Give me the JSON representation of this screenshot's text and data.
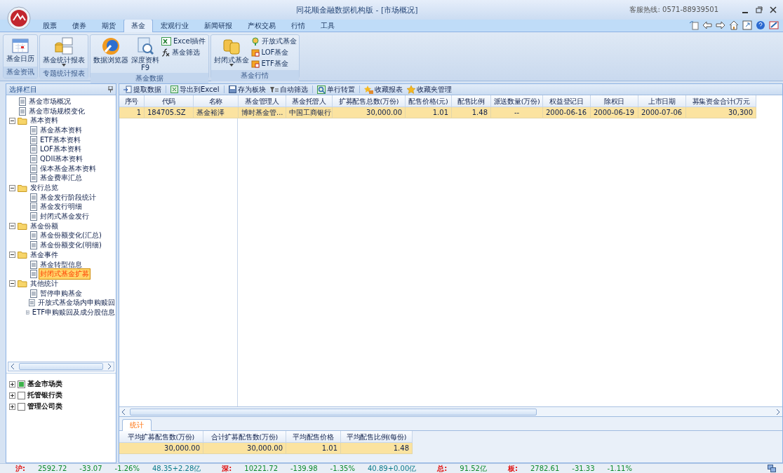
{
  "window": {
    "title": "同花顺金融数据机构版 - [市场概况]",
    "hotline": "客服热线: 0571-88939501"
  },
  "menu_tabs": [
    {
      "label": "股票",
      "selected": false
    },
    {
      "label": "债券",
      "selected": false
    },
    {
      "label": "期货",
      "selected": false
    },
    {
      "label": "基金",
      "selected": true
    },
    {
      "label": "宏观行业",
      "selected": false
    },
    {
      "label": "新闻研报",
      "selected": false
    },
    {
      "label": "产权交易",
      "selected": false
    },
    {
      "label": "行情",
      "selected": false
    },
    {
      "label": "工具",
      "selected": false
    }
  ],
  "ribbon": [
    {
      "label": "基金资讯",
      "items": [
        {
          "kind": "large",
          "label": "基金日历"
        }
      ]
    },
    {
      "label": "专题统计报表",
      "items": [
        {
          "kind": "large",
          "label": "基金统计报表",
          "dropdown": true
        }
      ]
    },
    {
      "label": "基金数据",
      "items": [
        {
          "kind": "large",
          "label": "数据浏览器"
        },
        {
          "kind": "large",
          "label": "深度资料",
          "sublabel": "F9"
        },
        {
          "kind": "small",
          "label": "Excel插件"
        },
        {
          "kind": "small",
          "label": "基金筛选"
        }
      ]
    },
    {
      "label": "基金行情",
      "items": [
        {
          "kind": "large",
          "label": "封闭式基金",
          "dropdown": true
        },
        {
          "kind": "small",
          "label": "开放式基金"
        },
        {
          "kind": "small",
          "label": "LOF基金"
        },
        {
          "kind": "small",
          "label": "ETF基金"
        }
      ]
    }
  ],
  "sidebar": {
    "title": "选择栏目",
    "tree": [
      {
        "label": "基金市场概况",
        "kind": "doc",
        "selected": false
      },
      {
        "label": "基金市场规模变化",
        "kind": "doc",
        "selected": false
      },
      {
        "label": "基本资料",
        "kind": "folder",
        "expanded": true,
        "selected": false,
        "children": [
          {
            "label": "基金基本资料",
            "kind": "doc",
            "selected": false
          },
          {
            "label": "ETF基本资料",
            "kind": "doc",
            "selected": false
          },
          {
            "label": "LOF基本资料",
            "kind": "doc",
            "selected": false
          },
          {
            "label": "QDII基本资料",
            "kind": "doc",
            "selected": false
          },
          {
            "label": "保本基金基本资料",
            "kind": "doc",
            "selected": false
          },
          {
            "label": "基金费率汇总",
            "kind": "doc",
            "selected": false
          }
        ]
      },
      {
        "label": "发行总览",
        "kind": "folder",
        "expanded": true,
        "selected": false,
        "children": [
          {
            "label": "基金发行阶段统计",
            "kind": "doc",
            "selected": false
          },
          {
            "label": "基金发行明细",
            "kind": "doc",
            "selected": false
          },
          {
            "label": "封闭式基金发行",
            "kind": "doc",
            "selected": false
          }
        ]
      },
      {
        "label": "基金份额",
        "kind": "folder",
        "expanded": true,
        "selected": false,
        "children": [
          {
            "label": "基金份额变化(汇总)",
            "kind": "doc",
            "selected": false
          },
          {
            "label": "基金份额变化(明细)",
            "kind": "doc",
            "selected": false
          }
        ]
      },
      {
        "label": "基金事件",
        "kind": "folder",
        "expanded": true,
        "selected": false,
        "children": [
          {
            "label": "基金转型信息",
            "kind": "doc",
            "selected": false
          },
          {
            "label": "封闭式基金扩募",
            "kind": "doc",
            "selected": true
          }
        ]
      },
      {
        "label": "其他统计",
        "kind": "folder",
        "expanded": true,
        "selected": false,
        "children": [
          {
            "label": "暂停申购基金",
            "kind": "doc",
            "selected": false
          },
          {
            "label": "开放式基金场内申购赎回",
            "kind": "doc",
            "selected": false
          },
          {
            "label": "ETF申购赎回及成分股信息",
            "kind": "doc",
            "selected": false
          }
        ]
      }
    ],
    "categories": [
      {
        "label": "基金市场类",
        "checked": true
      },
      {
        "label": "托管银行类",
        "checked": false
      },
      {
        "label": "管理公司类",
        "checked": false
      }
    ]
  },
  "toolbar": [
    "提取数据",
    "导出到Excel",
    "存为板块",
    "自动筛选",
    "单行转置",
    "收藏报表",
    "收藏夹管理"
  ],
  "table": {
    "columns": [
      {
        "label": "序号",
        "kind": "number"
      },
      {
        "label": "代码",
        "kind": "text"
      },
      {
        "label": "名称",
        "kind": "text"
      },
      {
        "label": "基金管理人",
        "kind": "text"
      },
      {
        "label": "基金托管人",
        "kind": "text"
      },
      {
        "label": "扩募配售总数(万份)",
        "kind": "number"
      },
      {
        "label": "配售价格(元)",
        "kind": "number"
      },
      {
        "label": "配售比例",
        "kind": "number"
      },
      {
        "label": "派送数量(万份)",
        "kind": "center"
      },
      {
        "label": "权益登记日",
        "kind": "text"
      },
      {
        "label": "除权日",
        "kind": "text"
      },
      {
        "label": "上市日期",
        "kind": "text"
      },
      {
        "label": "募集资金合计(万元",
        "kind": "number"
      }
    ],
    "rows": [
      {
        "selected": true,
        "cells": [
          "1",
          "184705.SZ",
          "基金裕泽",
          "博时基金管...",
          "中国工商银行",
          "30,000.00",
          "1.01",
          "1.48",
          "--",
          "2000-06-16",
          "2000-06-19",
          "2000-07-06",
          "30,300"
        ]
      }
    ]
  },
  "stats": {
    "tabs": [
      {
        "label": "统计",
        "selected": true
      }
    ],
    "columns": [
      "平均扩募配售数(万份)",
      "合计扩募配售数(万份)",
      "平均配售价格",
      "平均配售比例(每份)"
    ],
    "rows": [
      {
        "selected": true,
        "cells": [
          "30,000.00",
          "30,000.00",
          "1.01",
          "1.48"
        ]
      }
    ]
  },
  "status_bar": [
    {
      "text": "沪:",
      "kind": "market"
    },
    {
      "text": "2592.72",
      "kind": "change"
    },
    {
      "text": "-33.07",
      "kind": "change"
    },
    {
      "text": "-1.26%",
      "kind": "change"
    },
    {
      "text": "48.35+2.28亿",
      "kind": "volume"
    },
    {
      "text": "深:",
      "kind": "market"
    },
    {
      "text": "10221.72",
      "kind": "change"
    },
    {
      "text": "-139.98",
      "kind": "change"
    },
    {
      "text": "-1.35%",
      "kind": "change"
    },
    {
      "text": "40.89+0.00亿",
      "kind": "volume"
    },
    {
      "text": "总:",
      "kind": "market"
    },
    {
      "text": "91.52亿",
      "kind": "change"
    },
    {
      "text": "板:",
      "kind": "market"
    },
    {
      "text": "2782.61",
      "kind": "change"
    },
    {
      "text": "-31.33",
      "kind": "change"
    },
    {
      "text": "-1.11%",
      "kind": "change"
    }
  ]
}
